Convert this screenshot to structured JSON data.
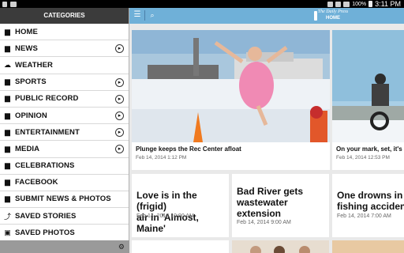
{
  "status_bar": {
    "time": "3:11 PM",
    "battery": "100%",
    "icons": [
      "usb-icon",
      "image-icon",
      "mute-icon",
      "no-sim-icon",
      "wifi-icon",
      "battery-icon"
    ]
  },
  "sidebar": {
    "title": "CATEGORIES",
    "items": [
      {
        "label": "HOME",
        "icon": "newspaper-icon",
        "has_sub": false
      },
      {
        "label": "NEWS",
        "icon": "newspaper-icon",
        "has_sub": true
      },
      {
        "label": "WEATHER",
        "icon": "cloud-icon",
        "has_sub": false
      },
      {
        "label": "SPORTS",
        "icon": "newspaper-icon",
        "has_sub": true
      },
      {
        "label": "PUBLIC RECORD",
        "icon": "newspaper-icon",
        "has_sub": true
      },
      {
        "label": "OPINION",
        "icon": "newspaper-icon",
        "has_sub": true
      },
      {
        "label": "ENTERTAINMENT",
        "icon": "newspaper-icon",
        "has_sub": true
      },
      {
        "label": "MEDIA",
        "icon": "newspaper-icon",
        "has_sub": true
      },
      {
        "label": "CELEBRATIONS",
        "icon": "newspaper-icon",
        "has_sub": false
      },
      {
        "label": "FACEBOOK",
        "icon": "newspaper-icon",
        "has_sub": false
      },
      {
        "label": "SUBMIT NEWS & PHOTOS",
        "icon": "newspaper-icon",
        "has_sub": false
      },
      {
        "label": "SAVED STORIES",
        "icon": "saved-icon",
        "has_sub": false
      },
      {
        "label": "SAVED PHOTOS",
        "icon": "camera-icon",
        "has_sub": false
      }
    ]
  },
  "topbar": {
    "logo_name": "The Daily Press",
    "section": "HOME"
  },
  "cards": {
    "plunge": {
      "caption": "Plunge keeps the Rec Center afloat",
      "date": "Feb 14, 2014 1:12 PM"
    },
    "mark": {
      "caption": "On your mark, set, it's a c",
      "date": "Feb 14, 2014 12:53 PM"
    },
    "love": {
      "headline_l1": "Love is in the (frigid)",
      "headline_l2": "air in 'Almost, Maine'",
      "date": "Feb 14, 2014 10:00 AM"
    },
    "bad_river": {
      "headline_l1": "Bad River gets",
      "headline_l2": "wastewater",
      "headline_l3": "extension",
      "date": "Feb 14, 2014 9:00 AM"
    },
    "drowns": {
      "headline_l1": "One drowns in ic",
      "headline_l2": "fishing accident",
      "date": "Feb 14, 2014 7:00 AM"
    }
  },
  "colors": {
    "accent": "#6fb0d8",
    "sidebar_head": "#3b3b3b",
    "feed_bg": "#e9e9e9"
  }
}
